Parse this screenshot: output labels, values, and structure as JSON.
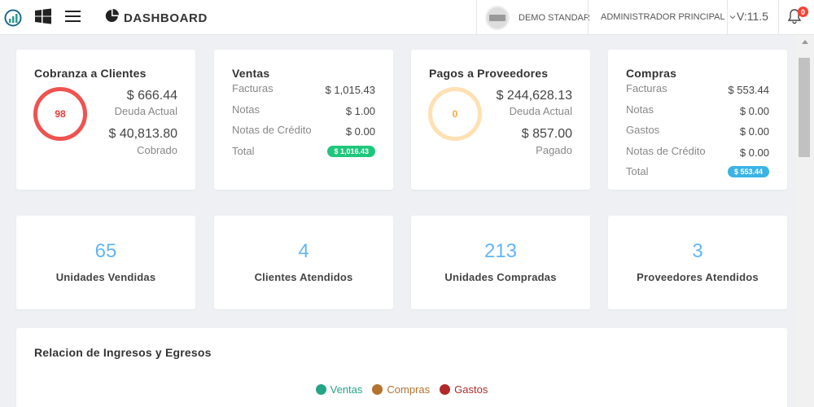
{
  "header": {
    "title": "DASHBOARD",
    "company": "DEMO STANDAR",
    "user": "ADMINISTRADOR PRINCIPAL",
    "version": "V:11.5",
    "notifications": "0"
  },
  "colors": {
    "red_ring": "#ef5350",
    "yellow_ring": "#ffe0b2",
    "green_pill": "#1ec77b",
    "blue_pill": "#3bb4e5",
    "stat_number": "#64b5f6",
    "legend_ventas": "#26a586",
    "legend_compras": "#b5722f",
    "legend_gastos": "#b02a2a"
  },
  "cobranza": {
    "title": "Cobranza a Clientes",
    "percent": "98",
    "deuda_amount": "$ 666.44",
    "deuda_label": "Deuda Actual",
    "cobrado_amount": "$ 40,813.80",
    "cobrado_label": "Cobrado"
  },
  "ventas": {
    "title": "Ventas",
    "rows": [
      {
        "label": "Facturas",
        "value": "$ 1,015.43"
      },
      {
        "label": "Notas",
        "value": "$ 1.00"
      },
      {
        "label": "Notas de Crédito",
        "value": "$ 0.00"
      }
    ],
    "total_label": "Total",
    "total_value": "$ 1,016.43"
  },
  "pagos": {
    "title": "Pagos a Proveedores",
    "percent": "0",
    "deuda_amount": "$ 244,628.13",
    "deuda_label": "Deuda Actual",
    "pagado_amount": "$ 857.00",
    "pagado_label": "Pagado"
  },
  "compras": {
    "title": "Compras",
    "rows": [
      {
        "label": "Facturas",
        "value": "$ 553.44"
      },
      {
        "label": "Notas",
        "value": "$ 0.00"
      },
      {
        "label": "Gastos",
        "value": "$ 0.00"
      },
      {
        "label": "Notas de Crédito",
        "value": "$ 0.00"
      }
    ],
    "total_label": "Total",
    "total_value": "$ 553.44"
  },
  "stats": [
    {
      "number": "65",
      "label": "Unidades Vendidas"
    },
    {
      "number": "4",
      "label": "Clientes Atendidos"
    },
    {
      "number": "213",
      "label": "Unidades Compradas"
    },
    {
      "number": "3",
      "label": "Proveedores Atendidos"
    }
  ],
  "relacion": {
    "title": "Relacion de Ingresos y Egresos",
    "legend": [
      "Ventas",
      "Compras",
      "Gastos"
    ]
  }
}
